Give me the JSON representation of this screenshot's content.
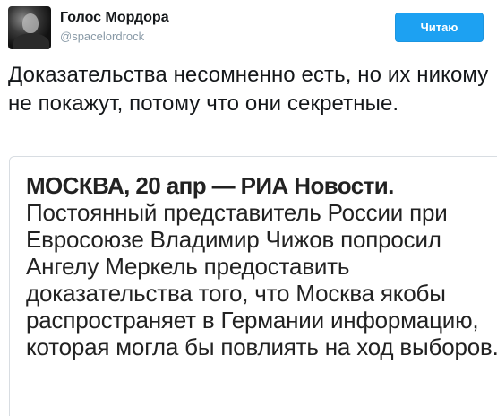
{
  "account": {
    "display_name": "Голос Мордора",
    "handle": "@spacelordrock",
    "avatar_icon": "user-avatar-photo"
  },
  "follow_button": {
    "label": "Читаю",
    "color": "#1da1f2"
  },
  "tweet": {
    "text": "Доказательства несомненно есть, но их никому не покажут, потому что они секретные."
  },
  "quote": {
    "lead": "МОСКВА, 20 апр — РИА Новости.",
    "body": " Постоянный представитель России при Евросоюзе Владимир Чижов попросил Ангелу Меркель предоставить доказательства того, что Москва якобы распространяет в Германии информацию, которая могла бы повлиять на ход выборов."
  }
}
